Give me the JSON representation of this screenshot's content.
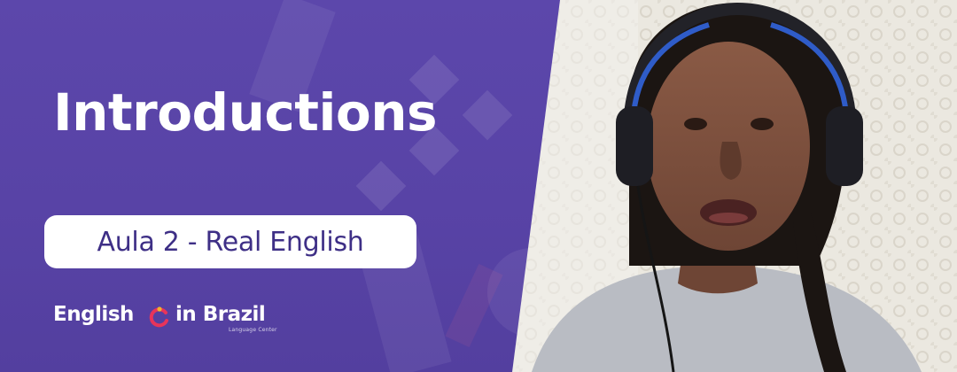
{
  "banner": {
    "title": "Introductions",
    "subtitle_pill": "Aula 2 - Real English",
    "logo": {
      "word_left": "English",
      "word_right": "in Brazil",
      "tagline": "Language Center"
    }
  },
  "colors": {
    "panel": "#5a44a6",
    "pill_text": "#3e2f86",
    "logo_mark_primary": "#e8345a",
    "logo_mark_secondary": "#f2b22b"
  },
  "photo": {
    "subject": "person wearing headphones"
  }
}
